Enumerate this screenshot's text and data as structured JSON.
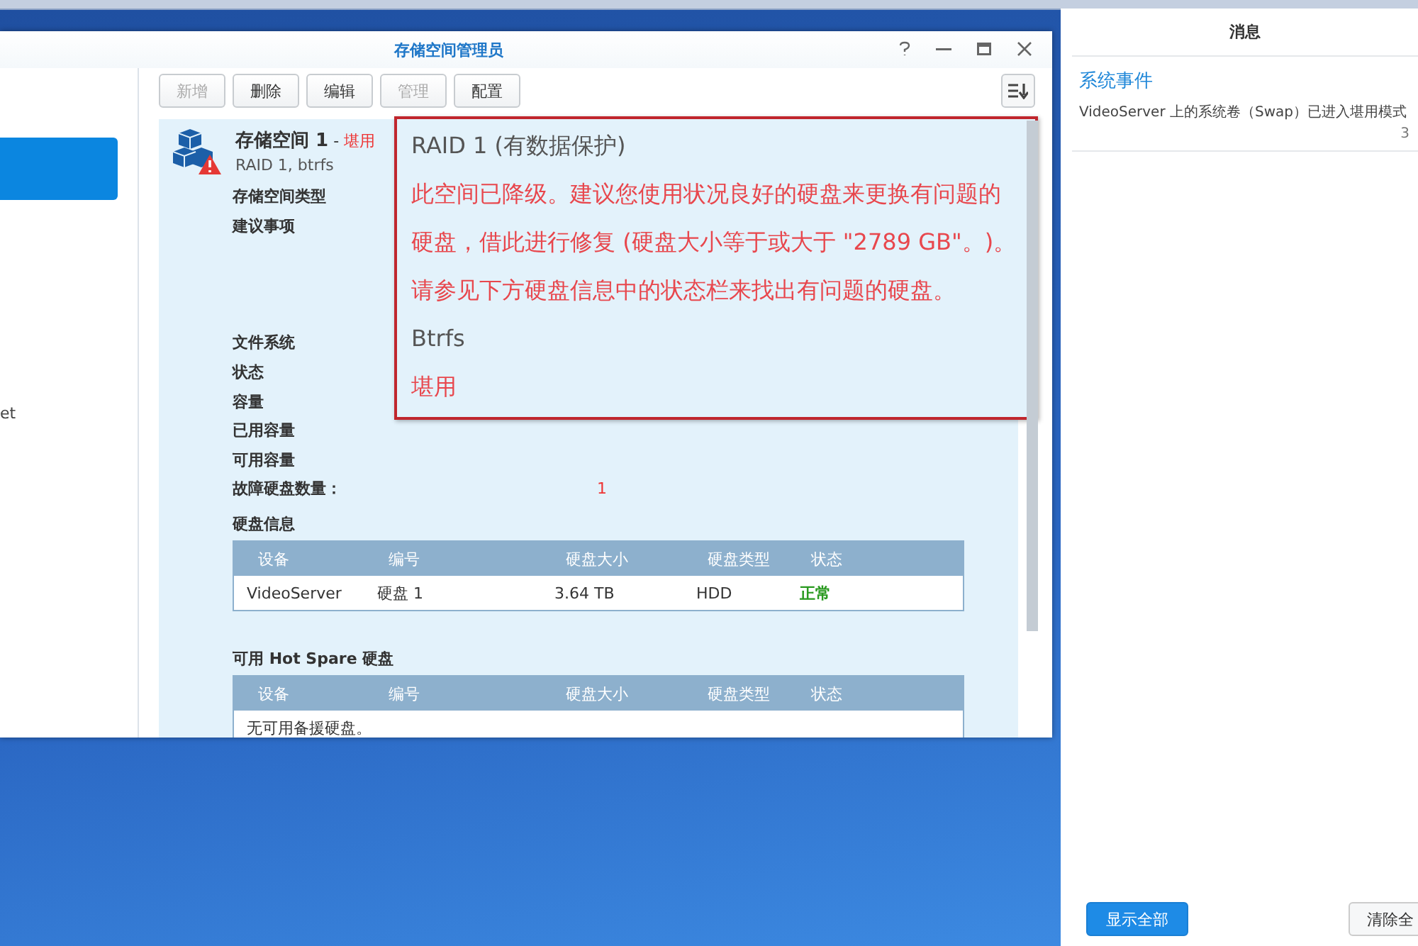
{
  "window": {
    "title": "存储空间管理员"
  },
  "sidebar": {
    "items": [
      {
        "label": "et",
        "selected": false
      }
    ]
  },
  "toolbar": {
    "buttons": [
      {
        "label": "新增",
        "disabled": true
      },
      {
        "label": "删除",
        "disabled": false
      },
      {
        "label": "编辑",
        "disabled": false
      },
      {
        "label": "管理",
        "disabled": true
      },
      {
        "label": "配置",
        "disabled": false
      }
    ]
  },
  "volume": {
    "name": "存储空间 1",
    "separator": " - ",
    "status": "堪用",
    "subtitle": "RAID 1, btrfs",
    "warning": true,
    "properties": [
      {
        "label": "存储空间类型"
      },
      {
        "label": "建议事项",
        "tall": true
      },
      {
        "label": "文件系统"
      },
      {
        "label": "状态"
      },
      {
        "label": "容量"
      },
      {
        "label": "已用容量"
      },
      {
        "label": "可用容量"
      },
      {
        "label": "故障硬盘数量：",
        "value": "1"
      }
    ]
  },
  "callout": {
    "lines": [
      {
        "kind": "normal",
        "text": "RAID 1 (有数据保护)"
      },
      {
        "kind": "alert",
        "text": "此空间已降级。建议您使用状况良好的硬盘来更换有问题的硬盘，借此进行修复 (硬盘大小等于或大于 \"2789 GB\"。)。请参见下方硬盘信息中的状态栏来找出有问题的硬盘。"
      },
      {
        "kind": "normal",
        "text": "Btrfs"
      },
      {
        "kind": "alert",
        "text": "堪用"
      }
    ]
  },
  "disk_info": {
    "title": "硬盘信息",
    "columns": [
      "设备",
      "编号",
      "硬盘大小",
      "硬盘类型",
      "状态"
    ],
    "rows": [
      {
        "cells": [
          "VideoServer",
          "硬盘 1",
          "3.64 TB",
          "HDD"
        ],
        "status": "正常",
        "healthy": true
      }
    ]
  },
  "hot_spare": {
    "title": "可用 Hot Spare 硬盘",
    "columns": [
      "设备",
      "编号",
      "硬盘大小",
      "硬盘类型",
      "状态"
    ],
    "empty_message": "无可用备援硬盘。"
  },
  "notifications": {
    "title": "消息",
    "items": [
      {
        "category": "系统事件",
        "message": "VideoServer 上的系统卷（Swap）已进入堪用模式",
        "time": "3"
      }
    ],
    "buttons": [
      {
        "label": "显示全部",
        "primary": true
      },
      {
        "label": "清除全",
        "primary": false
      }
    ]
  }
}
